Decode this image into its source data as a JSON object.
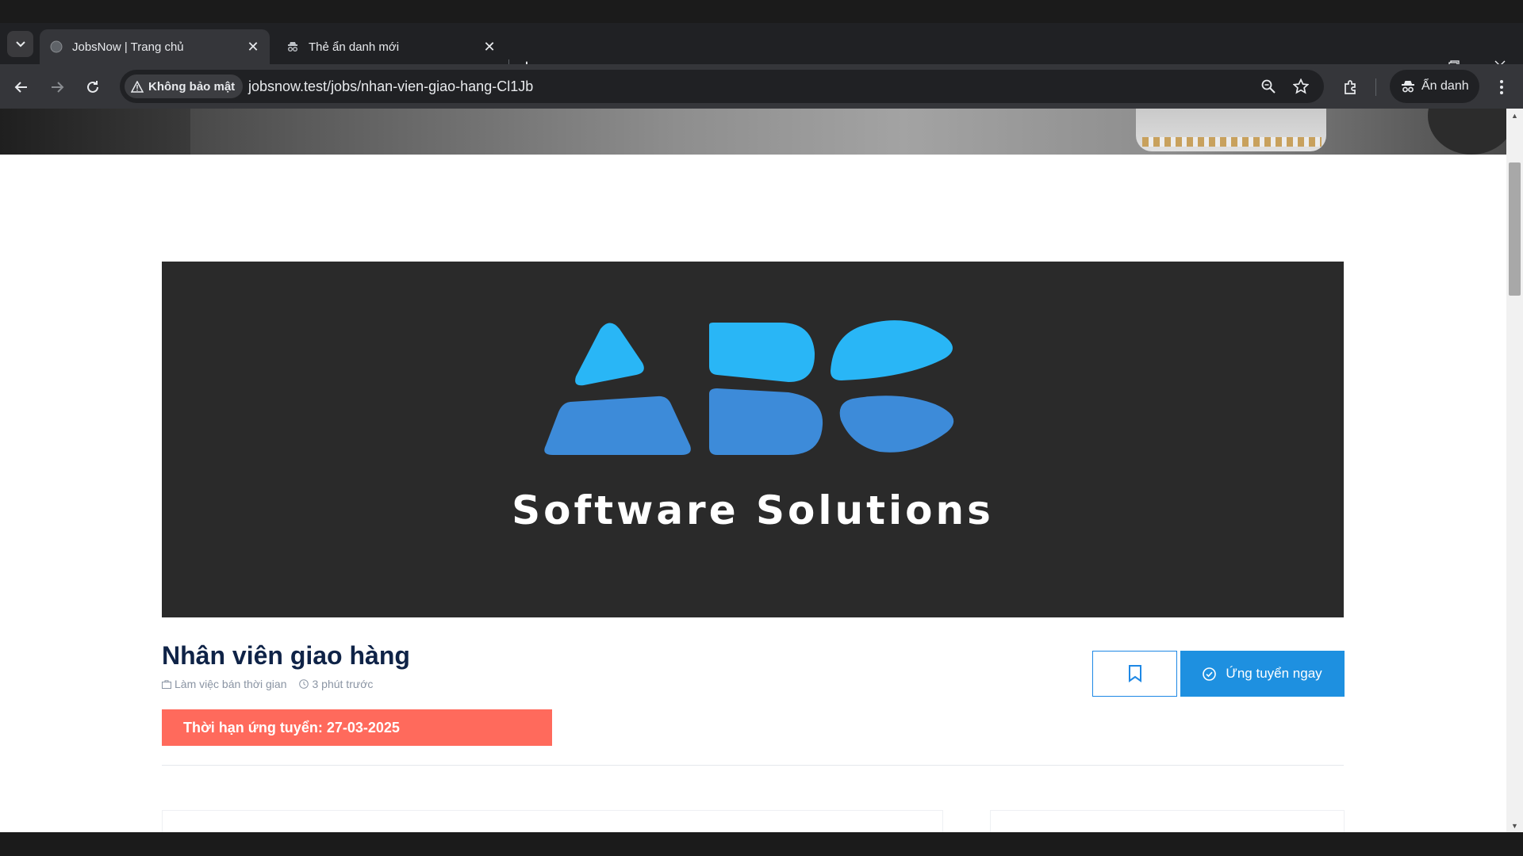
{
  "browser": {
    "tabs": [
      {
        "title": "JobsNow | Trang chủ",
        "active": true,
        "icon": "globe-icon"
      },
      {
        "title": "Thẻ ẩn danh mới",
        "active": false,
        "icon": "incognito-icon"
      }
    ],
    "security_label": "Không bảo mật",
    "url": "jobsnow.test/jobs/nhan-vien-giao-hang-Cl1Jb",
    "profile_label": "Ẩn danh"
  },
  "banner": {
    "logo_text": "Software Solutions",
    "colors": {
      "light_blue": "#29b6f6",
      "dark_blue": "#3d8bd9",
      "background": "#2a2a2a"
    }
  },
  "job": {
    "title": "Nhân viên giao hàng",
    "type": "Làm việc bán thời gian",
    "posted": "3 phút trước",
    "deadline": "Thời hạn ứng tuyển: 27-03-2025",
    "apply_label": "Ứng tuyển ngay",
    "colors": {
      "title": "#0f2347",
      "deadline_bg": "#ff6a5c",
      "apply_bg": "#1e90e0"
    }
  }
}
